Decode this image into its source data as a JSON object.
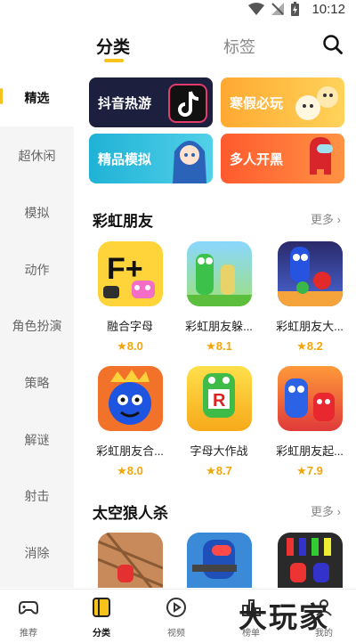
{
  "status_bar": {
    "time": "10:12"
  },
  "header": {
    "tab_category": "分类",
    "tab_tags": "标签"
  },
  "sidebar": {
    "items": [
      "精选",
      "超休闲",
      "模拟",
      "动作",
      "角色扮演",
      "策略",
      "解谜",
      "射击",
      "消除"
    ],
    "selected": "精选"
  },
  "banners": [
    {
      "label": "抖音热游",
      "color": "#1b1f3b"
    },
    {
      "label": "寒假必玩",
      "color": "#ffb84a"
    },
    {
      "label": "精品模拟",
      "color": "#2bb6d6"
    },
    {
      "label": "多人开黑",
      "color": "#ff6a3d"
    }
  ],
  "sections": [
    {
      "title": "彩虹朋友",
      "more": "更多",
      "games": [
        {
          "name": "融合字母",
          "rating": "8.0"
        },
        {
          "name": "彩虹朋友躲...",
          "rating": "8.1"
        },
        {
          "name": "彩虹朋友大...",
          "rating": "8.2"
        },
        {
          "name": "彩虹朋友合...",
          "rating": "8.0"
        },
        {
          "name": "字母大作战",
          "rating": "8.7"
        },
        {
          "name": "彩虹朋友起...",
          "rating": "7.9"
        }
      ]
    },
    {
      "title": "太空狼人杀",
      "more": "更多"
    }
  ],
  "bottom_nav": [
    {
      "label": "推荐",
      "icon": "gamepad-icon"
    },
    {
      "label": "分类",
      "icon": "category-icon"
    },
    {
      "label": "视频",
      "icon": "play-icon"
    },
    {
      "label": "榜单",
      "icon": "ranking-icon"
    },
    {
      "label": "我的",
      "icon": "profile-icon"
    }
  ],
  "watermark": "大玩家",
  "colors": {
    "accent": "#f7c21a",
    "rating": "#f2a60c"
  }
}
